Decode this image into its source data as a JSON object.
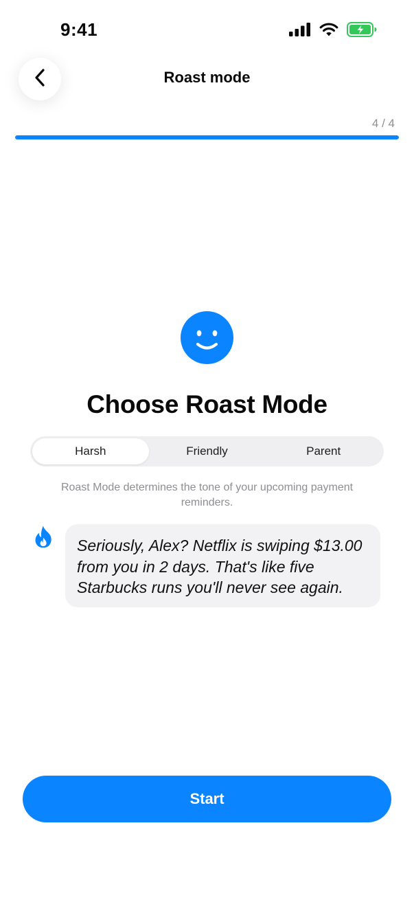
{
  "status_bar": {
    "time": "9:41",
    "icons": [
      "cellular-signal-icon",
      "wifi-icon",
      "battery-charging-icon"
    ]
  },
  "header": {
    "back_icon": "chevron-left-icon",
    "title": "Roast mode"
  },
  "progress": {
    "step_label": "4 / 4",
    "current_step": 4,
    "total_steps": 4,
    "fill_fraction": 1.0
  },
  "main": {
    "emoji_icon": "smiley-face-icon",
    "title": "Choose Roast Mode",
    "modes": [
      {
        "label": "Harsh",
        "selected": true
      },
      {
        "label": "Friendly",
        "selected": false
      },
      {
        "label": "Parent",
        "selected": false
      }
    ],
    "description": "Roast Mode determines the tone of your upcoming payment reminders.",
    "preview": {
      "icon": "fire-icon",
      "lines": [
        "Seriously, Alex? Netflix is swiping $13.00",
        "from you in 2 days. That's like five",
        "Starbucks runs you'll never see again."
      ]
    }
  },
  "footer": {
    "start_label": "Start"
  },
  "colors": {
    "accent": "#0a84ff",
    "segment_bg": "#efeff1",
    "bubble_bg": "#f2f2f5",
    "muted_text": "#8e8e93",
    "battery_green": "#34c759"
  }
}
